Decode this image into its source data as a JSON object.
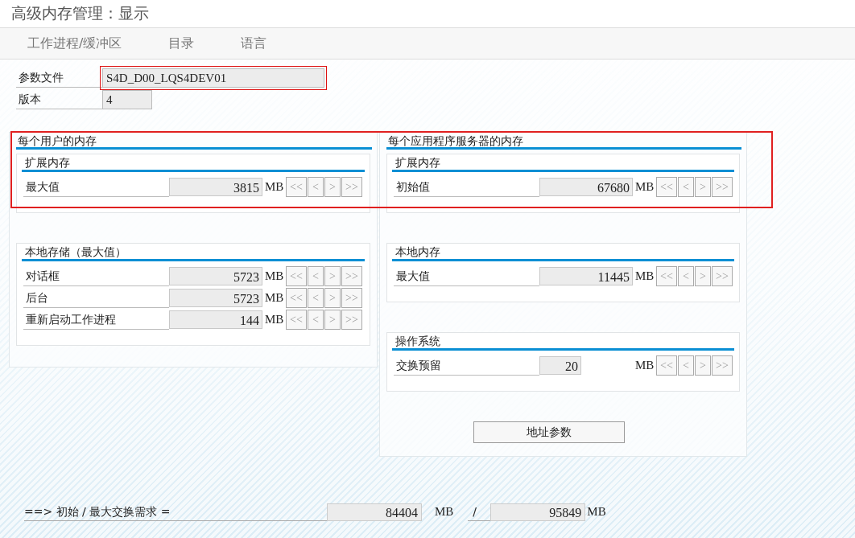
{
  "window": {
    "title": "高级内存管理：显示"
  },
  "toolbar": [
    "工作进程/缓冲区",
    "目录",
    "语言"
  ],
  "header_fields": [
    {
      "label": "参数文件",
      "value": "S4D_D00_LQS4DEV01",
      "focused": true,
      "kind": "wide"
    },
    {
      "label": "版本",
      "value": "4",
      "focused": false,
      "kind": "narrow"
    }
  ],
  "groups": [
    {
      "title": "每个用户的内存",
      "sections": [
        {
          "title": "扩展内存",
          "rows": [
            {
              "label": "最大值",
              "value": "3815",
              "unit": "MB",
              "kind": "wide",
              "buttons": [
                "<<",
                "<",
                ">",
                ">>"
              ]
            }
          ]
        },
        {
          "title": "本地存储（最大值）",
          "rows": [
            {
              "label": "对话框",
              "value": "5723",
              "unit": "MB",
              "kind": "wide",
              "buttons": [
                "<<",
                "<",
                ">",
                ">>"
              ]
            },
            {
              "label": "后台",
              "value": "5723",
              "unit": "MB",
              "kind": "wide",
              "buttons": [
                "<<",
                "<",
                ">",
                ">>"
              ]
            },
            {
              "label": "重新启动工作进程",
              "value": "144",
              "unit": "MB",
              "kind": "wide",
              "buttons": [
                "<<",
                "<",
                ">",
                ">>"
              ]
            }
          ]
        }
      ]
    },
    {
      "title": "每个应用程序服务器的内存",
      "sections": [
        {
          "title": "扩展内存",
          "rows": [
            {
              "label": "初始值",
              "value": "67680",
              "unit": "MB",
              "kind": "wide",
              "buttons": [
                "<<",
                "<",
                ">",
                ">>"
              ]
            }
          ]
        },
        {
          "title": "本地内存",
          "rows": [
            {
              "label": "最大值",
              "value": "11445",
              "unit": "MB",
              "kind": "wide",
              "buttons": [
                "<<",
                "<",
                ">",
                ">>"
              ]
            }
          ]
        },
        {
          "title": "操作系统",
          "rows": [
            {
              "label": "交换预留",
              "value": "20",
              "unit": "MB",
              "kind": "narrow",
              "buttons": [
                "<<",
                "<",
                ">",
                ">>"
              ]
            }
          ]
        }
      ],
      "button": "地址参数"
    }
  ],
  "footer": {
    "label": "==> 初始 / 最大交换需求 =",
    "initial": "84404",
    "unit_1": "MB",
    "separator": "/",
    "maximum": "95849",
    "unit_2": "MB"
  }
}
